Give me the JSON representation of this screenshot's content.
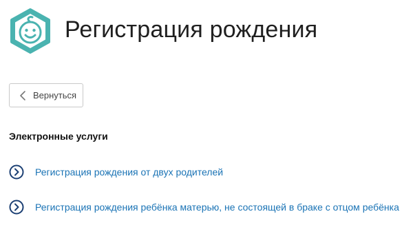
{
  "header": {
    "title": "Регистрация рождения",
    "logo_icon": "baby-face-hexagon-icon",
    "accent_color": "#4ab3b0"
  },
  "toolbar": {
    "back_label": "Вернуться",
    "back_icon": "chevron-left-icon"
  },
  "section": {
    "title": "Электронные услуги",
    "link_color": "#1a73b5",
    "items": [
      {
        "label": "Регистрация рождения от двух родителей",
        "icon": "circle-arrow-right-icon"
      },
      {
        "label": "Регистрация рождения ребёнка матерью, не состоящей в браке с отцом ребёнка",
        "icon": "circle-arrow-right-icon"
      }
    ]
  }
}
